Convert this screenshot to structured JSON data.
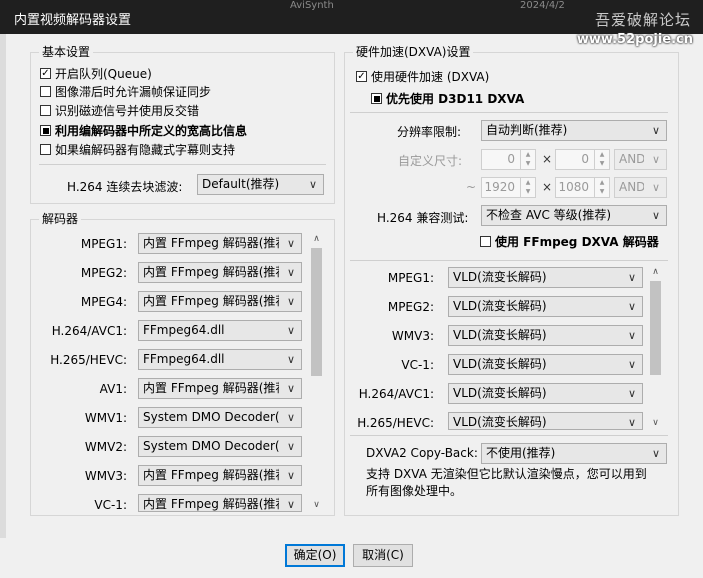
{
  "window": {
    "title": "内置视频解码器设置",
    "behind_title": "AviSynth",
    "behind_date": "2024/4/2",
    "watermark_cn": "吾爱破解论坛",
    "watermark_url": "www.52pojie.cn"
  },
  "basic": {
    "title": "基本设置",
    "queue": {
      "label": "开启队列(Queue)",
      "state": "checked"
    },
    "allow_drop": {
      "label": "图像滞后时允许漏帧保证同步",
      "state": "unchecked"
    },
    "tape_signal": {
      "label": "识别磁迹信号并使用反交错",
      "state": "unchecked"
    },
    "aspect_ratio": {
      "label": "利用编解码器中所定义的宽高比信息",
      "state": "indeterminate"
    },
    "closed_caption": {
      "label": "如果编解码器有隐藏式字幕则支持",
      "state": "unchecked"
    },
    "h264_deblock_label": "H.264 连续去块滤波:",
    "h264_deblock_value": "Default(推荐)"
  },
  "decoders": {
    "title": "解码器",
    "rows": [
      {
        "label": "MPEG1:",
        "value": "内置 FFmpeg 解码器(推荐)"
      },
      {
        "label": "MPEG2:",
        "value": "内置 FFmpeg 解码器(推荐)"
      },
      {
        "label": "MPEG4:",
        "value": "内置 FFmpeg 解码器(推荐)"
      },
      {
        "label": "H.264/AVC1:",
        "value": "FFmpeg64.dll"
      },
      {
        "label": "H.265/HEVC:",
        "value": "FFmpeg64.dll"
      },
      {
        "label": "AV1:",
        "value": "内置 FFmpeg 解码器(推荐)"
      },
      {
        "label": "WMV1:",
        "value": "System DMO Decoder(推荐)"
      },
      {
        "label": "WMV2:",
        "value": "System DMO Decoder(推荐)"
      },
      {
        "label": "WMV3:",
        "value": "内置 FFmpeg 解码器(推荐)"
      },
      {
        "label": "VC-1:",
        "value": "内置 FFmpeg 解码器(推荐)"
      }
    ]
  },
  "hw": {
    "title": "硬件加速(DXVA)设置",
    "use_dxva": {
      "label": "使用硬件加速 (DXVA)",
      "state": "checked"
    },
    "prefer_d3d11": {
      "label": "优先使用 D3D11 DXVA",
      "state": "indeterminate"
    },
    "resolution_label": "分辨率限制:",
    "resolution_value": "自动判断(推荐)",
    "custom_label": "自定义尺寸:",
    "custom_w": "0",
    "custom_h": "0",
    "custom_op": "AND",
    "tilde": "~",
    "max_w": "1920",
    "max_h": "1080",
    "max_op": "AND",
    "times": "×",
    "h264_compat_label": "H.264 兼容测试:",
    "h264_compat_value": "不检查 AVC 等级(推荐)",
    "use_ffmpeg_dxva": {
      "label": "使用 FFmpeg DXVA 解码器",
      "state": "unchecked"
    },
    "rows": [
      {
        "label": "MPEG1:",
        "value": "VLD(流变长解码)"
      },
      {
        "label": "MPEG2:",
        "value": "VLD(流变长解码)"
      },
      {
        "label": "WMV3:",
        "value": "VLD(流变长解码)"
      },
      {
        "label": "VC-1:",
        "value": "VLD(流变长解码)"
      },
      {
        "label": "H.264/AVC1:",
        "value": "VLD(流变长解码)"
      },
      {
        "label": "H.265/HEVC:",
        "value": "VLD(流变长解码)"
      }
    ],
    "copyback_label": "DXVA2 Copy-Back:",
    "copyback_value": "不使用(推荐)",
    "note_line1": "支持 DXVA 无渲染但它比默认渲染慢点，您可以用到",
    "note_line2": "所有图像处理中。"
  },
  "buttons": {
    "ok": "确定(O)",
    "cancel": "取消(C)"
  }
}
